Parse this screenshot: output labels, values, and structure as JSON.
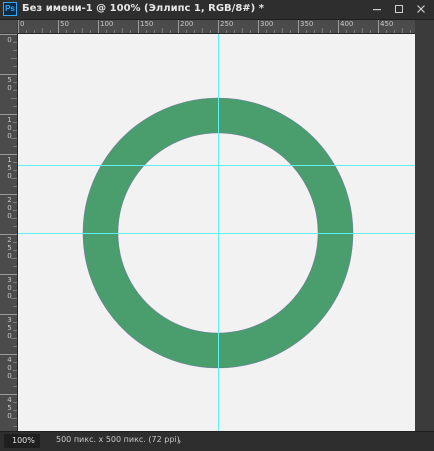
{
  "app": {
    "icon_label": "Ps"
  },
  "document": {
    "title": "Без имени-1 @ 100% (Эллипс 1, RGB/8#) *"
  },
  "window_controls": [
    "minimize-icon",
    "maximize-icon",
    "close-icon"
  ],
  "ruler_horizontal": [
    "0",
    "50",
    "100",
    "150",
    "200",
    "250",
    "300",
    "350",
    "400",
    "450"
  ],
  "ruler_vertical": [
    "0",
    "5 0",
    "1 0 0",
    "1 5 0",
    "2 0 0",
    "2 5 0",
    "3 0 0",
    "3 5 0",
    "4 0 0",
    "4 5 0"
  ],
  "shape": {
    "name": "Эллипс 1",
    "type": "ring",
    "fill": "#4a9e6e",
    "canvas_bg": "#f2f2f2"
  },
  "guides": {
    "color": "#5ff1f1",
    "orientation": [
      "vertical",
      "horizontal",
      "horizontal"
    ]
  },
  "status": {
    "zoom": "100%",
    "doc_info": "500 пикс. x 500 пикс. (72 ppi)",
    "arrow": "›"
  }
}
